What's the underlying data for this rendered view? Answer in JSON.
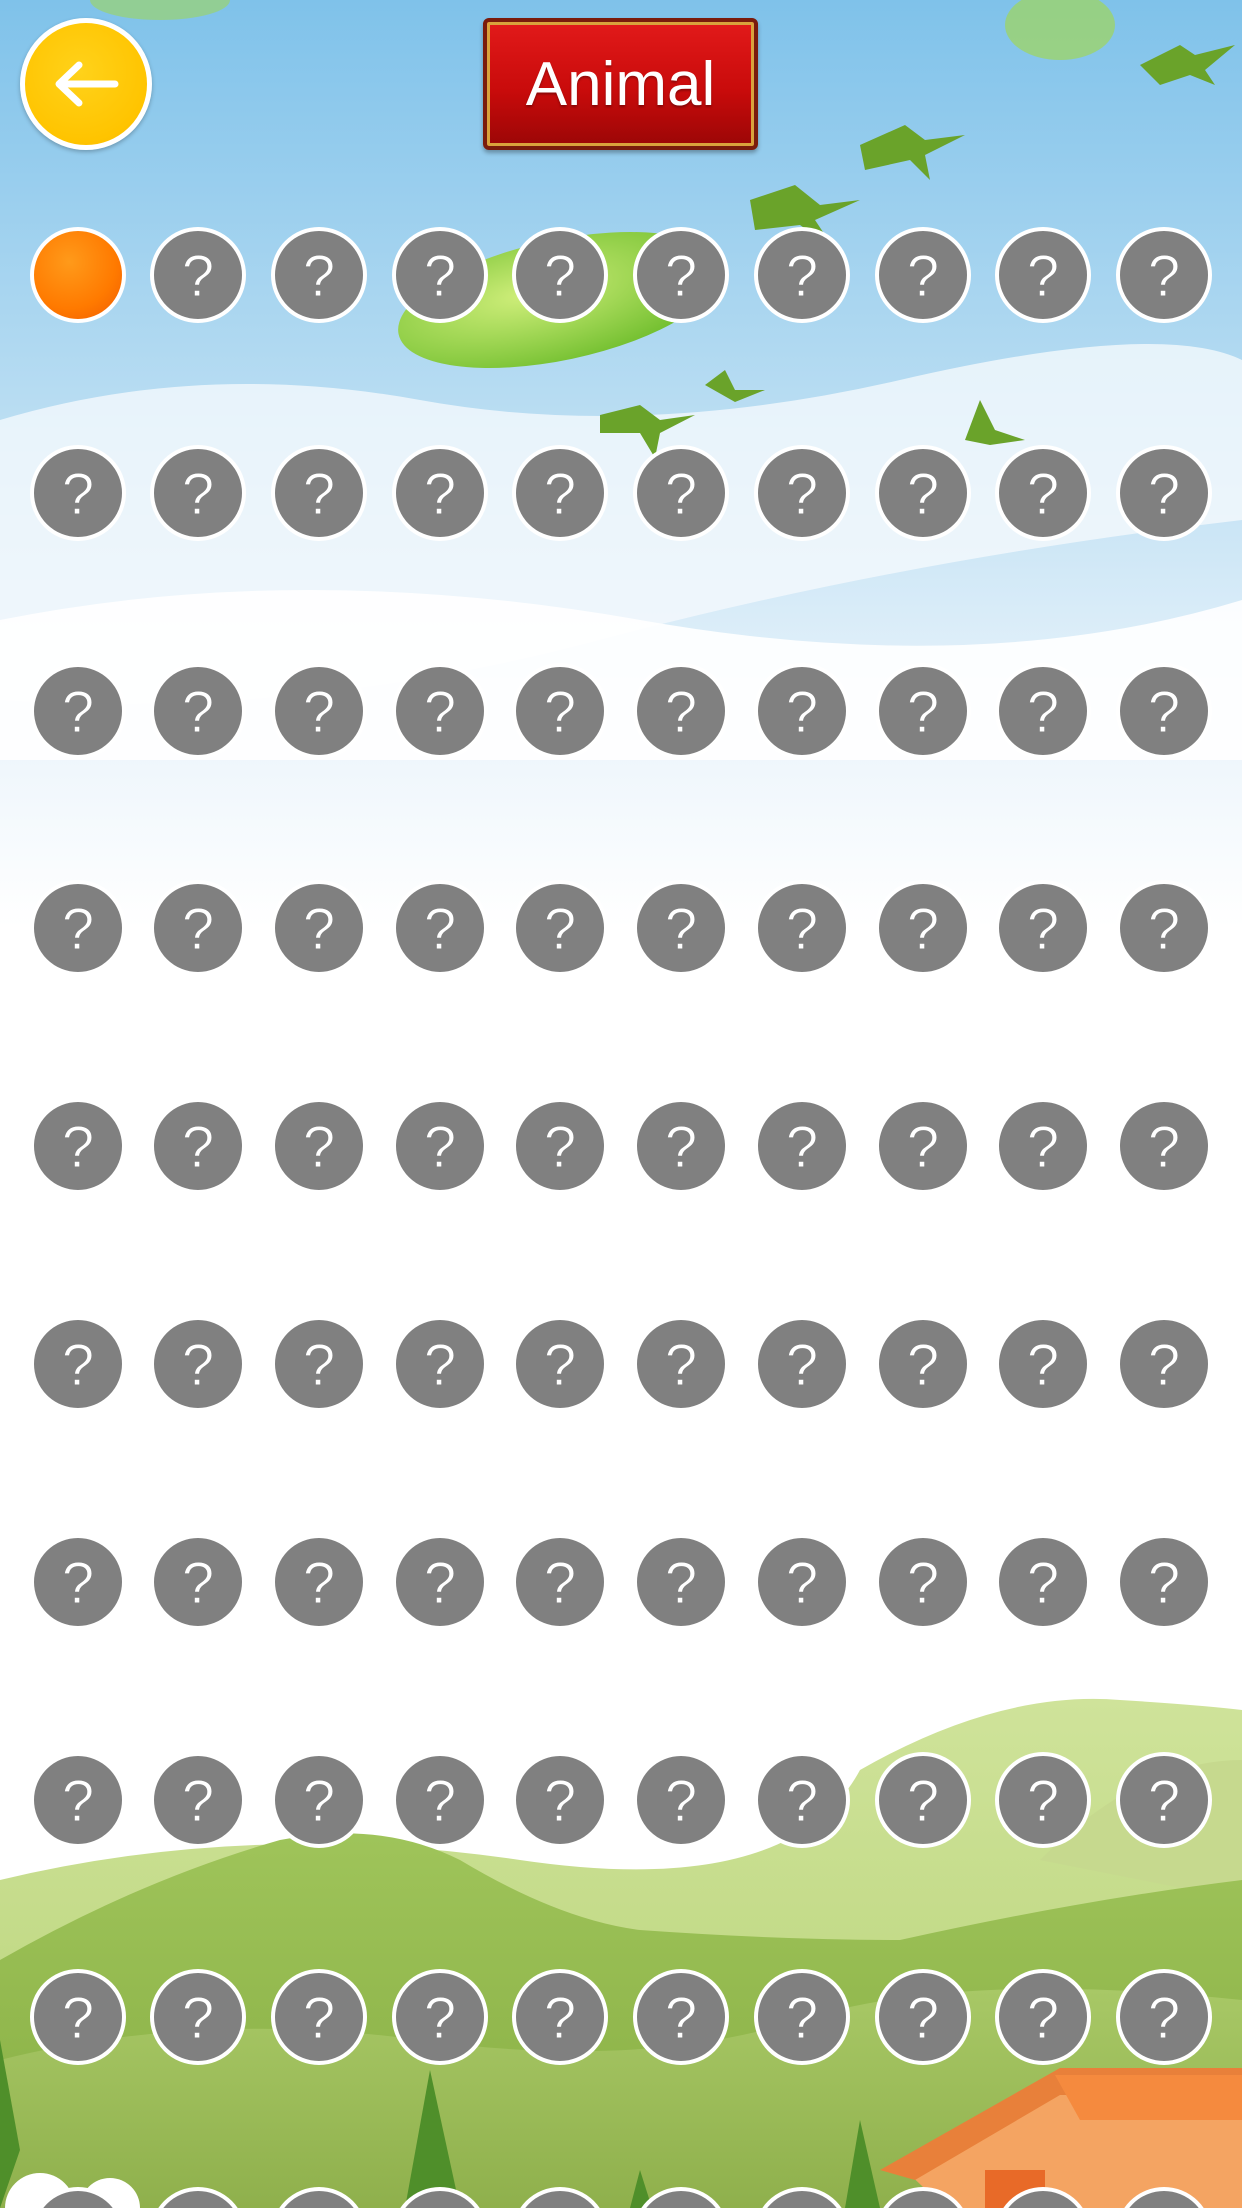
{
  "header": {
    "back_icon": "left-arrow-icon",
    "title": "Animal"
  },
  "colors": {
    "locked": "#808080",
    "current": "#ff7a00",
    "back_button": "#ffc400",
    "title_plate": "#c90b0b"
  },
  "levels": {
    "locked_symbol": "?",
    "current_index": 1,
    "columns": 10,
    "visible_rows": 10
  }
}
